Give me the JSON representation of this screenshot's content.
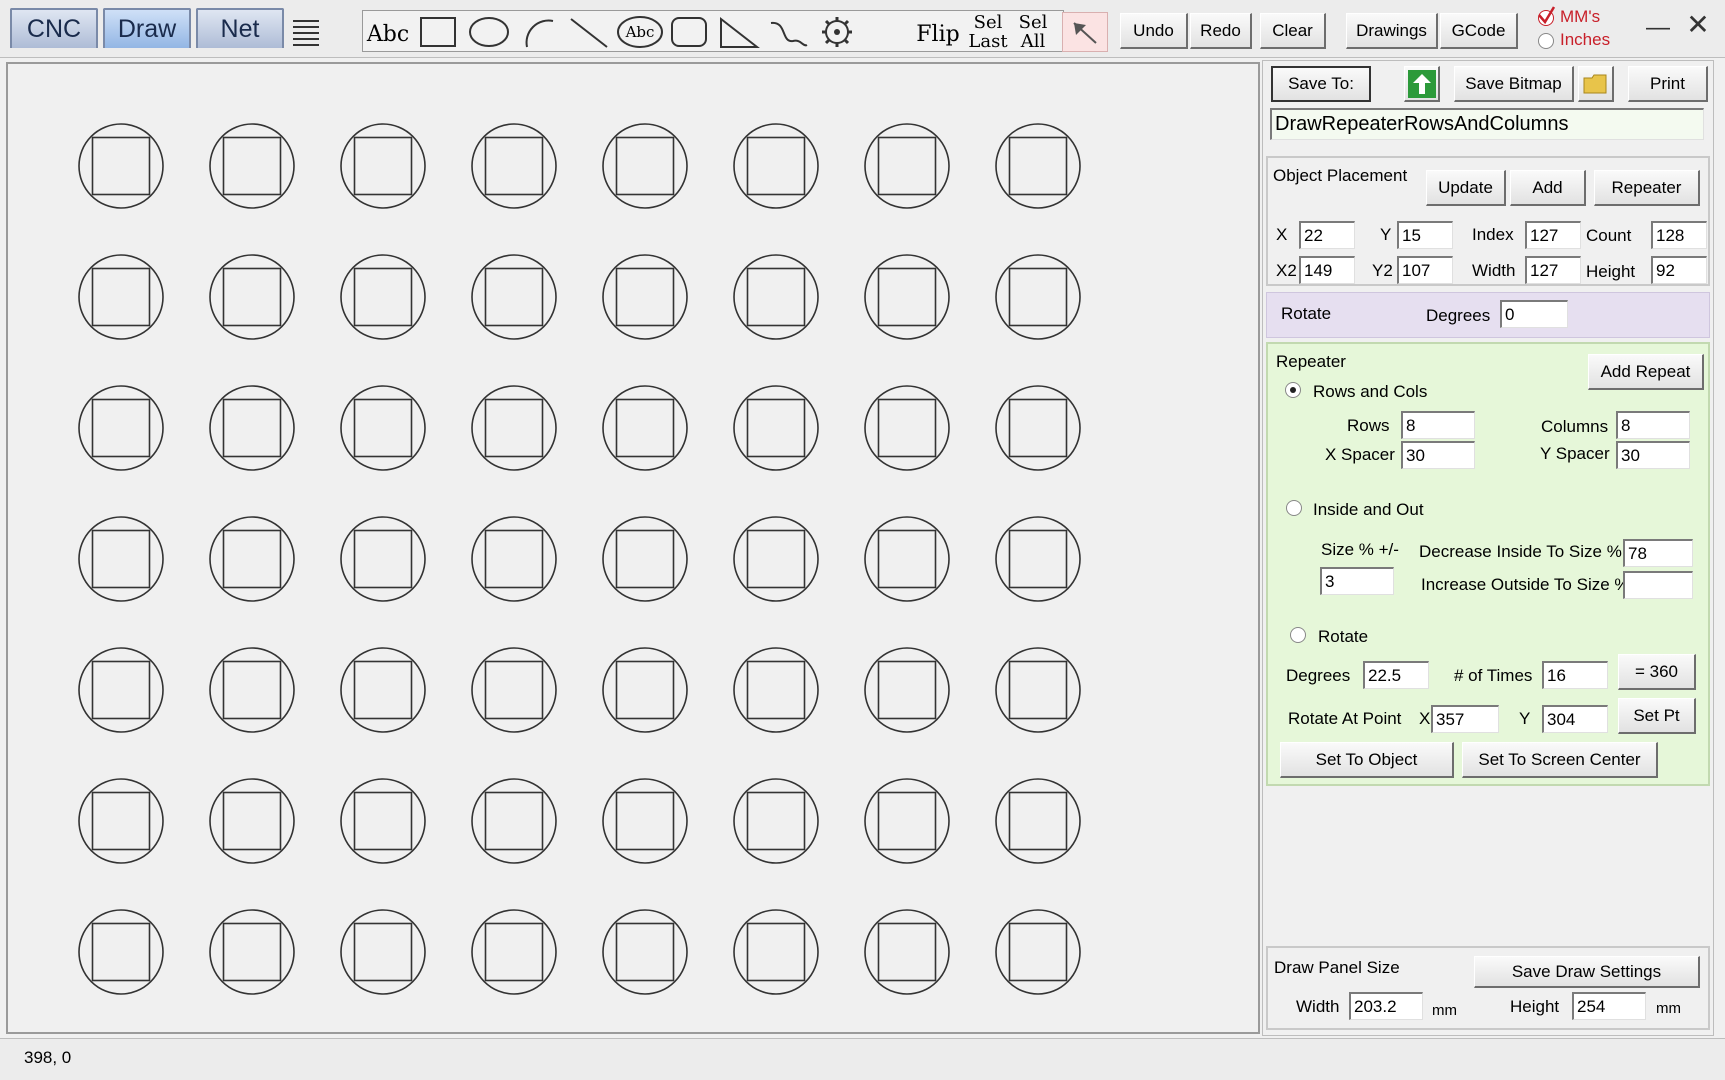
{
  "tabs": [
    {
      "label": "CNC",
      "active": false
    },
    {
      "label": "Draw",
      "active": true
    },
    {
      "label": "Net",
      "active": false
    }
  ],
  "toolbar": {
    "abc_label": "Abc",
    "circle_text_label": "Abc",
    "flip_label": "Flip",
    "sel_last_label_1": "Sel",
    "sel_last_label_2": "Last",
    "sel_all_label_1": "Sel",
    "sel_all_label_2": "All",
    "undo_label": "Undo",
    "redo_label": "Redo",
    "clear_label": "Clear",
    "drawings_label": "Drawings",
    "gcode_label": "GCode",
    "units_mm_label": "MM's",
    "units_inches_label": "Inches",
    "minimize_glyph": "—",
    "close_glyph": "✕"
  },
  "save": {
    "save_to_label": "Save To:",
    "save_bitmap_label": "Save Bitmap",
    "print_label": "Print",
    "filename": "DrawRepeaterRowsAndColumns"
  },
  "object_placement": {
    "title": "Object Placement",
    "update_label": "Update",
    "add_label": "Add",
    "repeater_label": "Repeater",
    "x_label": "X",
    "x": "22",
    "y_label": "Y",
    "y": "15",
    "index_label": "Index",
    "index": "127",
    "count_label": "Count",
    "count": "128",
    "x2_label": "X2",
    "x2": "149",
    "y2_label": "Y2",
    "y2": "107",
    "width_label": "Width",
    "width": "127",
    "height_label": "Height",
    "height": "92"
  },
  "rotate_panel": {
    "title": "Rotate",
    "degrees_label": "Degrees",
    "degrees": "0"
  },
  "repeater": {
    "title": "Repeater",
    "add_repeat_label": "Add Repeat",
    "mode_rows_cols_label": "Rows and Cols",
    "rows_label": "Rows",
    "rows": "8",
    "columns_label": "Columns",
    "columns": "8",
    "x_spacer_label": "X Spacer",
    "x_spacer": "30",
    "y_spacer_label": "Y Spacer",
    "y_spacer": "30",
    "mode_inside_out_label": "Inside and Out",
    "size_pct_label": "Size % +/-",
    "size_pct": "3",
    "decrease_label": "Decrease Inside To Size %",
    "decrease": "78",
    "increase_label": "Increase Outside To Size %",
    "increase": "",
    "mode_rotate_label": "Rotate",
    "rot_degrees_label": "Degrees",
    "rot_degrees": "22.5",
    "times_label": "# of Times",
    "times": "16",
    "eq360_label": "= 360",
    "rotate_at_label": "Rotate At Point",
    "pt_x_label": "X",
    "pt_x": "357",
    "pt_y_label": "Y",
    "pt_y": "304",
    "set_pt_label": "Set Pt",
    "set_object_label": "Set To Object",
    "set_center_label": "Set To Screen Center",
    "selected_mode": "rows_cols"
  },
  "draw_panel": {
    "title": "Draw Panel Size",
    "save_settings_label": "Save Draw Settings",
    "width_label": "Width",
    "width": "203.2",
    "width_unit": "mm",
    "height_label": "Height",
    "height": "254",
    "height_unit": "mm"
  },
  "status": {
    "coords": "398, 0"
  },
  "grid": {
    "rows": 8,
    "visible_rows": 7,
    "columns": 8
  },
  "colors": {
    "panel_purple": "#e6dff0",
    "panel_green": "#e6f7d9",
    "tab_active": "#a9c6ea",
    "tab_inactive": "#b9c6dc",
    "red_check": "#c8202a",
    "green_arrow": "#2c9a3a"
  }
}
